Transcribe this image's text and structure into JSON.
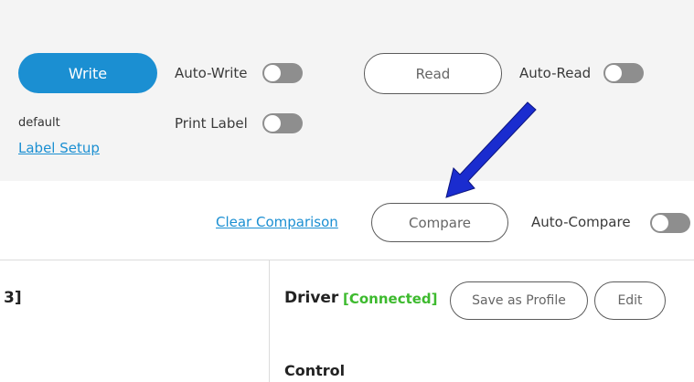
{
  "write_panel": {
    "write_label": "Write",
    "auto_write_label": "Auto-Write",
    "auto_write_on": false,
    "read_label": "Read",
    "auto_read_label": "Auto-Read",
    "auto_read_on": false,
    "profile_name": "default",
    "print_label_label": "Print Label",
    "print_label_on": false,
    "label_setup_link": "Label Setup"
  },
  "compare_bar": {
    "clear_comparison_link": "Clear Comparison",
    "compare_label": "Compare",
    "auto_compare_label": "Auto-Compare",
    "auto_compare_on": false
  },
  "left_panel": {
    "title_fragment": "3]"
  },
  "driver_panel": {
    "title": "Driver",
    "status": "[Connected]",
    "save_as_profile_label": "Save as Profile",
    "edit_label": "Edit",
    "section_heading": "Control"
  },
  "colors": {
    "primary": "#1b8fd2",
    "connected": "#3dba2e",
    "arrow": "#1a2ccf"
  }
}
